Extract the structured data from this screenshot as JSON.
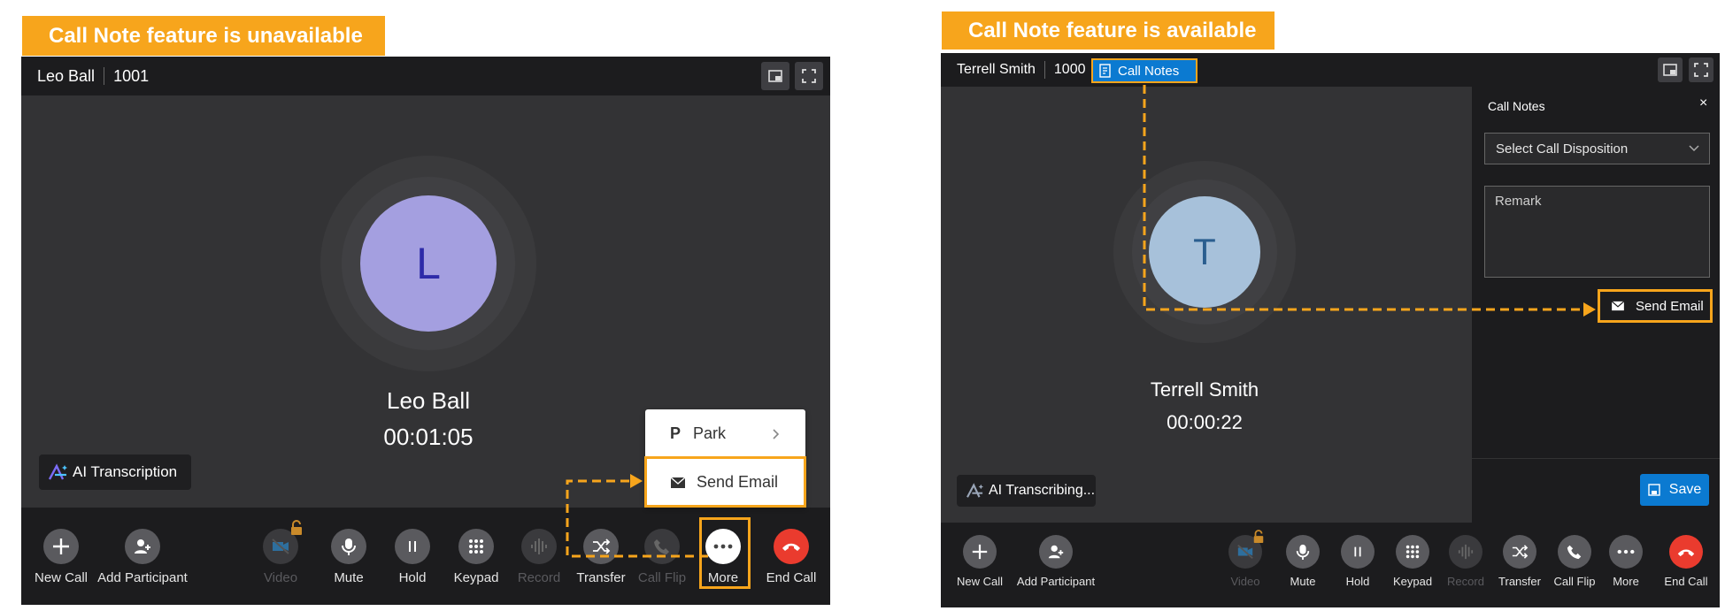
{
  "left": {
    "banner": "Call Note feature is unavailable",
    "caller_name": "Leo Ball",
    "caller_number": "1001",
    "avatar_letter": "L",
    "call_time": "00:01:05",
    "ai_button": "AI Transcription",
    "menu": {
      "park": "Park",
      "park_prefix": "P",
      "send_email": "Send Email"
    },
    "toolbar": {
      "new_call": "New Call",
      "add_participant": "Add Participant",
      "video": "Video",
      "mute": "Mute",
      "hold": "Hold",
      "keypad": "Keypad",
      "record": "Record",
      "transfer": "Transfer",
      "call_flip": "Call Flip",
      "more": "More",
      "end_call": "End Call"
    }
  },
  "right": {
    "banner": "Call Note feature is available",
    "caller_name": "Terrell Smith",
    "caller_number": "1000",
    "call_notes_tag": "Call Notes",
    "avatar_letter": "T",
    "call_time": "00:00:22",
    "ai_button": "AI Transcribing...",
    "notes": {
      "title": "Call Notes",
      "close": "×",
      "select_placeholder": "Select Call Disposition",
      "remark_placeholder": "Remark",
      "send_email": "Send Email",
      "save": "Save"
    },
    "toolbar": {
      "new_call": "New Call",
      "add_participant": "Add Participant",
      "video": "Video",
      "mute": "Mute",
      "hold": "Hold",
      "keypad": "Keypad",
      "record": "Record",
      "transfer": "Transfer",
      "call_flip": "Call Flip",
      "more": "More",
      "end_call": "End Call"
    }
  },
  "colors": {
    "accent": "#f7a51c",
    "window_bg": "#333335",
    "bar_bg": "#1c1c1e",
    "avatar_left": "#a49fe0",
    "avatar_right": "#a7c1da",
    "end_call": "#ea3b2e",
    "primary_blue": "#0b7ad1"
  },
  "icons": {
    "ai": "ai-sparkle-icon",
    "pip": "picture-in-picture-icon",
    "fullscreen": "fullscreen-icon",
    "mail": "envelope-icon",
    "chevron": "chevron-down-icon",
    "save": "floppy-disk-icon"
  }
}
